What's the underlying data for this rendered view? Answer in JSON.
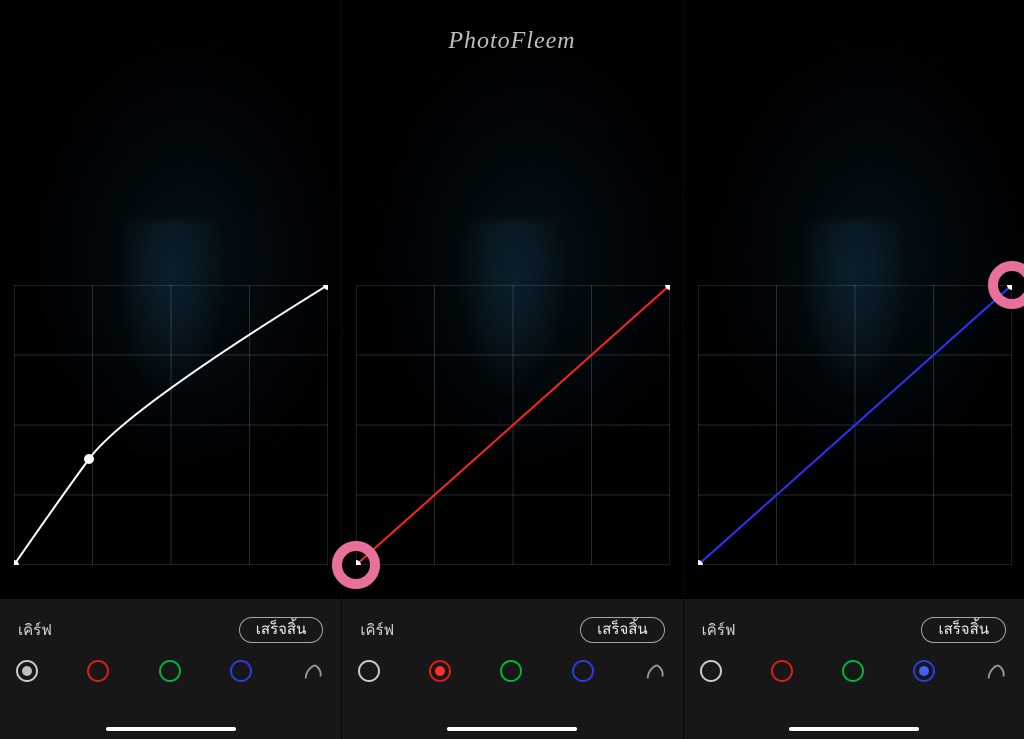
{
  "watermark": "PhotoFleem",
  "labels": {
    "curve": "เคิร์ฟ",
    "done": "เสร็จสิ้น"
  },
  "channels": {
    "white": "luminance",
    "red": "red",
    "green": "green",
    "blue": "blue",
    "reset": "reset"
  },
  "panels": [
    {
      "selected_channel": "white",
      "curve_color": "white",
      "highlight_node": null,
      "curve_points": [
        {
          "x": 0.0,
          "y": 0.0
        },
        {
          "x": 0.24,
          "y": 0.38
        },
        {
          "x": 1.0,
          "y": 1.0
        }
      ]
    },
    {
      "selected_channel": "red",
      "curve_color": "red",
      "highlight_node": "bottom-left",
      "curve_points": [
        {
          "x": 0.0,
          "y": 0.0
        },
        {
          "x": 1.0,
          "y": 1.0
        }
      ]
    },
    {
      "selected_channel": "blue",
      "curve_color": "blue",
      "highlight_node": "top-right",
      "curve_points": [
        {
          "x": 0.0,
          "y": 0.0
        },
        {
          "x": 1.0,
          "y": 1.0
        }
      ]
    }
  ]
}
